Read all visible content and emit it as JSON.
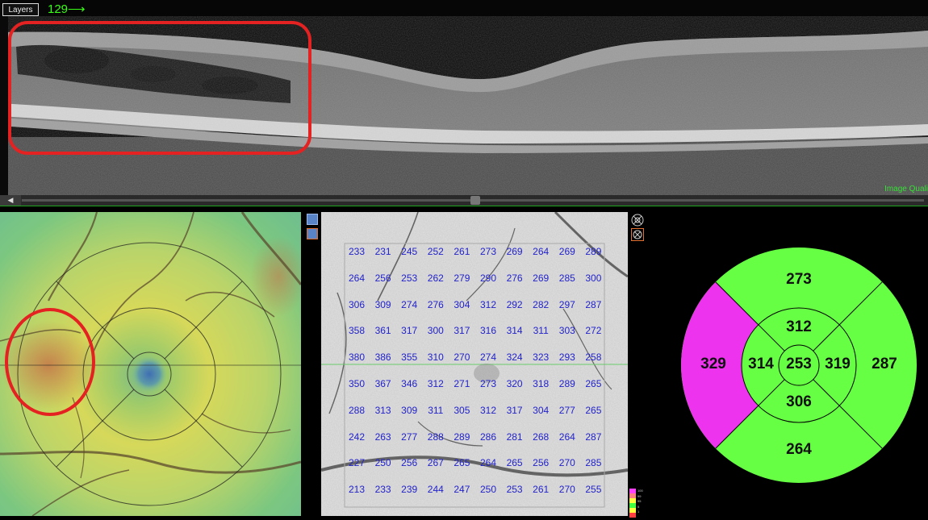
{
  "oct": {
    "layers_label": "Layers",
    "slice_number": "129",
    "slice_arrow": "⟶",
    "image_quality_label": "Image Quali"
  },
  "thickness_grid": {
    "rows": [
      [
        "233",
        "231",
        "245",
        "252",
        "261",
        "273",
        "269",
        "264",
        "269",
        "289"
      ],
      [
        "264",
        "256",
        "253",
        "262",
        "279",
        "290",
        "276",
        "269",
        "285",
        "300"
      ],
      [
        "306",
        "309",
        "274",
        "276",
        "304",
        "312",
        "292",
        "282",
        "297",
        "287"
      ],
      [
        "358",
        "361",
        "317",
        "300",
        "317",
        "316",
        "314",
        "311",
        "303",
        "272"
      ],
      [
        "380",
        "386",
        "355",
        "310",
        "270",
        "274",
        "324",
        "323",
        "293",
        "258"
      ],
      [
        "350",
        "367",
        "346",
        "312",
        "271",
        "273",
        "320",
        "318",
        "289",
        "265"
      ],
      [
        "288",
        "313",
        "309",
        "311",
        "305",
        "312",
        "317",
        "304",
        "277",
        "265"
      ],
      [
        "242",
        "263",
        "277",
        "288",
        "289",
        "286",
        "281",
        "268",
        "264",
        "287"
      ],
      [
        "227",
        "250",
        "256",
        "267",
        "265",
        "264",
        "265",
        "256",
        "270",
        "285"
      ],
      [
        "213",
        "233",
        "239",
        "244",
        "247",
        "250",
        "253",
        "261",
        "270",
        "255"
      ]
    ]
  },
  "etdrs": {
    "center": "253",
    "inner_superior": "312",
    "inner_nasal": "319",
    "inner_inferior": "306",
    "inner_temporal": "314",
    "outer_superior": "273",
    "outer_nasal": "287",
    "outer_inferior": "264",
    "outer_temporal": "329",
    "colors": {
      "normal": "#66ff44",
      "thick": "#ee33ee",
      "ring": "#000000"
    }
  },
  "colorbar": {
    "labels": [
      "100",
      "99",
      "95",
      "5",
      "1"
    ],
    "colors": [
      "#ff40ff",
      "#ff8080",
      "#ffff40",
      "#40ff40",
      "#ffff40",
      "#ff4040"
    ]
  },
  "colors": {
    "accent_green": "#39ff14",
    "annotation_red": "#e52222",
    "grid_text": "#2222cc"
  }
}
